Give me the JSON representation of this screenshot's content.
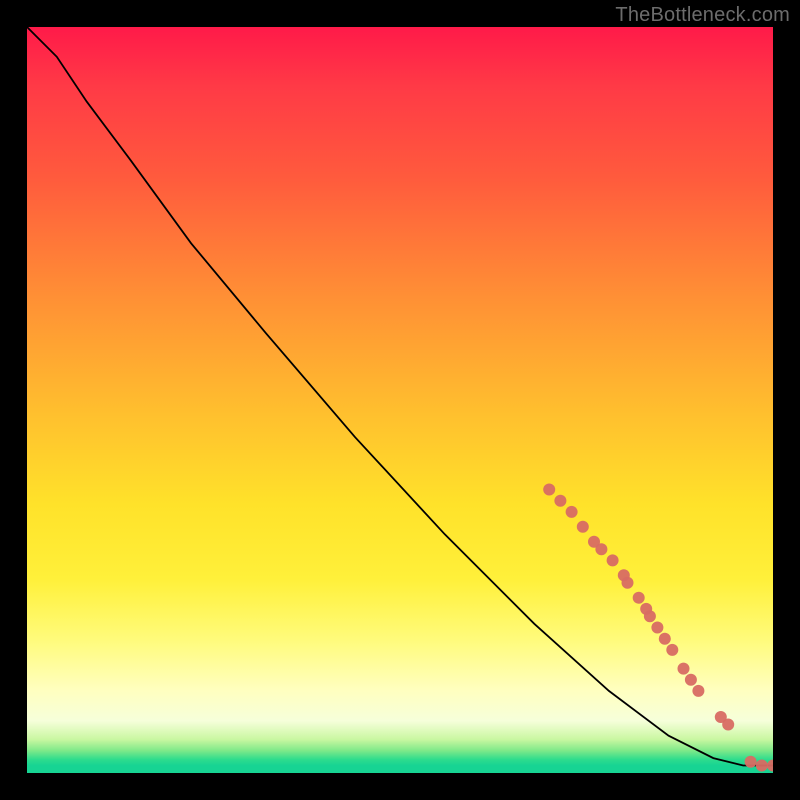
{
  "watermark": "TheBottleneck.com",
  "chart_data": {
    "type": "line",
    "title": "",
    "xlabel": "",
    "ylabel": "",
    "xlim": [
      0,
      100
    ],
    "ylim": [
      0,
      100
    ],
    "grid": false,
    "legend": false,
    "background_gradient": {
      "orientation": "vertical",
      "stops": [
        {
          "pos": 0.0,
          "color": "#ff1a49"
        },
        {
          "pos": 0.2,
          "color": "#ff5a3d"
        },
        {
          "pos": 0.5,
          "color": "#ffc22e"
        },
        {
          "pos": 0.75,
          "color": "#fff24a"
        },
        {
          "pos": 0.9,
          "color": "#ffffc8"
        },
        {
          "pos": 0.97,
          "color": "#7ee989"
        },
        {
          "pos": 1.0,
          "color": "#17d493"
        }
      ],
      "note": "green good / red bad heatmap-style bottleneck gradient"
    },
    "series": [
      {
        "name": "bottleneck-curve",
        "type": "line",
        "color": "#000000",
        "x": [
          0,
          4,
          8,
          14,
          22,
          32,
          44,
          56,
          68,
          78,
          86,
          92,
          96,
          100
        ],
        "y": [
          100,
          96,
          90,
          82,
          71,
          59,
          45,
          32,
          20,
          11,
          5,
          2,
          1,
          1
        ]
      },
      {
        "name": "hw-points",
        "type": "scatter",
        "color": "#d86b63",
        "marker_radius": 6,
        "x": [
          70,
          71.5,
          73,
          74.5,
          76,
          77,
          78.5,
          80,
          80.5,
          82,
          83,
          83.5,
          84.5,
          85.5,
          86.5,
          88,
          89,
          90,
          93,
          94,
          97,
          98.5,
          100
        ],
        "y": [
          38,
          36.5,
          35,
          33,
          31,
          30,
          28.5,
          26.5,
          25.5,
          23.5,
          22,
          21,
          19.5,
          18,
          16.5,
          14,
          12.5,
          11,
          7.5,
          6.5,
          1.5,
          1,
          1
        ]
      }
    ]
  }
}
